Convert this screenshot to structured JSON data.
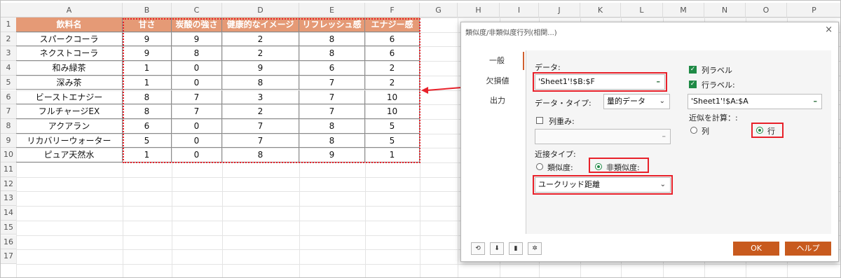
{
  "columns": [
    "A",
    "B",
    "C",
    "D",
    "E",
    "F",
    "G",
    "H",
    "I",
    "J",
    "K",
    "L",
    "M",
    "N",
    "O",
    "P"
  ],
  "rows": [
    "1",
    "2",
    "3",
    "4",
    "5",
    "6",
    "7",
    "8",
    "9",
    "10",
    "11",
    "12",
    "13",
    "14",
    "15",
    "16",
    "17"
  ],
  "table": {
    "headers": [
      "飲料名",
      "甘さ",
      "炭酸の強さ",
      "健康的なイメージ",
      "リフレッシュ感",
      "エナジー感"
    ],
    "records": [
      [
        "スパークコーラ",
        "9",
        "9",
        "2",
        "8",
        "6"
      ],
      [
        "ネクストコーラ",
        "9",
        "8",
        "2",
        "8",
        "6"
      ],
      [
        "和み緑茶",
        "1",
        "0",
        "9",
        "6",
        "2"
      ],
      [
        "深み茶",
        "1",
        "0",
        "8",
        "7",
        "2"
      ],
      [
        "ビーストエナジー",
        "8",
        "7",
        "3",
        "7",
        "10"
      ],
      [
        "フルチャージEX",
        "8",
        "7",
        "2",
        "7",
        "10"
      ],
      [
        "アクアラン",
        "6",
        "0",
        "7",
        "8",
        "5"
      ],
      [
        "リカバリーウォーター",
        "5",
        "0",
        "7",
        "8",
        "5"
      ],
      [
        "ピュア天然水",
        "1",
        "0",
        "8",
        "9",
        "1"
      ]
    ],
    "header_color": "#e59a76"
  },
  "dialog": {
    "title": "類似度/非類似度行列(相関...)",
    "close": "×",
    "tabs": [
      "一般",
      "欠損値",
      "出力"
    ],
    "data_label": "データ:",
    "data_value": "'Sheet1'!$B:$F",
    "data_type_label": "データ・タイプ:",
    "data_type_value": "量的データ",
    "weights_label": "列重み:",
    "proximity_type_label": "近接タイプ:",
    "similarity_label": "類似度:",
    "dissimilarity_label": "非類似度:",
    "distance_value": "ユークリッド距離",
    "col_labels": "列ラベル",
    "row_labels": "行ラベル:",
    "row_labels_value": "'Sheet1'!$A:$A",
    "compute_label": "近似を計算：:",
    "col_option": "列",
    "row_option": "行",
    "ok": "OK",
    "help": "ヘルプ",
    "dash": "–",
    "check": "✓"
  },
  "colors": {
    "accent": "#c85a1e",
    "green": "#1f8a46",
    "highlight": "#e8212a"
  }
}
